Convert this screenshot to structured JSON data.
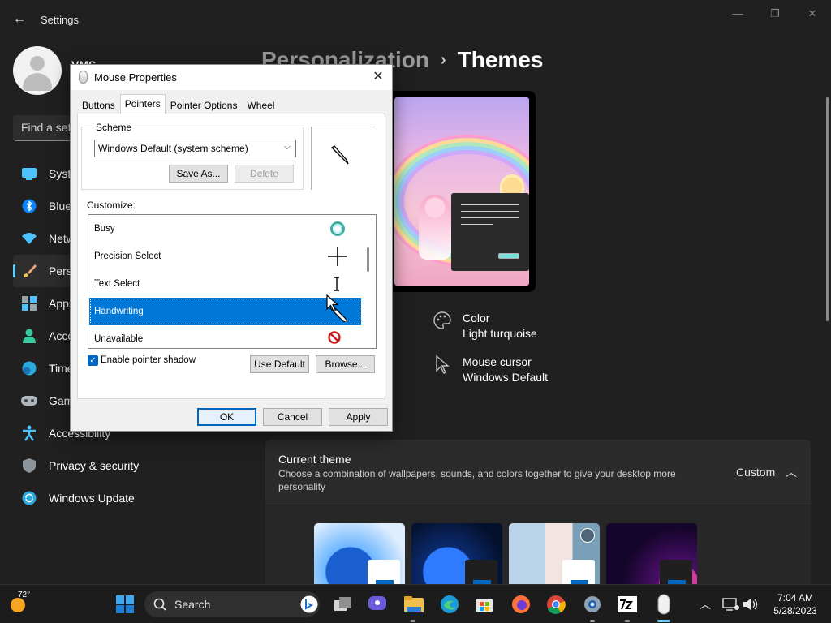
{
  "settings": {
    "app_title": "Settings",
    "user_name": "VMS",
    "search_placeholder": "Find a setting",
    "nav_items": [
      {
        "label": "System",
        "icon": "system-icon"
      },
      {
        "label": "Bluetooth & devices",
        "icon": "bluetooth-icon"
      },
      {
        "label": "Network & internet",
        "icon": "network-icon"
      },
      {
        "label": "Personalization",
        "icon": "personalization-icon",
        "active": true
      },
      {
        "label": "Apps",
        "icon": "apps-icon"
      },
      {
        "label": "Accounts",
        "icon": "accounts-icon"
      },
      {
        "label": "Time & language",
        "icon": "time-language-icon"
      },
      {
        "label": "Gaming",
        "icon": "gaming-icon"
      },
      {
        "label": "Accessibility",
        "icon": "accessibility-icon"
      },
      {
        "label": "Privacy & security",
        "icon": "privacy-icon"
      },
      {
        "label": "Windows Update",
        "icon": "windows-update-icon"
      }
    ],
    "breadcrumb": {
      "parent": "Personalization",
      "separator": "›",
      "current": "Themes"
    },
    "properties": {
      "color": {
        "title": "Color",
        "value": "Light turquoise",
        "icon": "palette-icon"
      },
      "cursor": {
        "title": "Mouse cursor",
        "value": "Windows Default",
        "icon": "mouse-cursor-icon"
      }
    },
    "current_theme": {
      "title": "Current theme",
      "description": "Choose a combination of wallpapers, sounds, and colors together to give your desktop more personality",
      "value": "Custom"
    },
    "accent_color": "#60cdff"
  },
  "dialog": {
    "title": "Mouse Properties",
    "tabs": [
      "Buttons",
      "Pointers",
      "Pointer Options",
      "Wheel"
    ],
    "active_tab": "Pointers",
    "scheme_label": "Scheme",
    "scheme_value": "Windows Default (system scheme)",
    "save_as": "Save As...",
    "delete": "Delete",
    "customize_label": "Customize:",
    "cursor_rows": [
      {
        "label": "Busy",
        "icon": "busy-ring-icon"
      },
      {
        "label": "Precision Select",
        "icon": "crosshair-icon"
      },
      {
        "label": "Text Select",
        "icon": "text-beam-icon"
      },
      {
        "label": "Handwriting",
        "icon": "pen-icon",
        "selected": true
      },
      {
        "label": "Unavailable",
        "icon": "unavailable-icon"
      }
    ],
    "shadow_label": "Enable pointer shadow",
    "shadow_checked": true,
    "use_default": "Use Default",
    "browse": "Browse...",
    "ok": "OK",
    "cancel": "Cancel",
    "apply": "Apply",
    "selection_color": "#0078d7"
  },
  "taskbar": {
    "temperature": "72°",
    "search_label": "Search",
    "time": "7:04 AM",
    "date": "5/28/2023",
    "apps": [
      "start-icon",
      "search-icon",
      "bing-icon",
      "task-view-icon",
      "chat-icon",
      "file-explorer-icon",
      "edge-icon",
      "store-icon",
      "firefox-icon",
      "chrome-icon",
      "settings-icon",
      "7zip-icon",
      "mouse-properties-icon"
    ]
  }
}
